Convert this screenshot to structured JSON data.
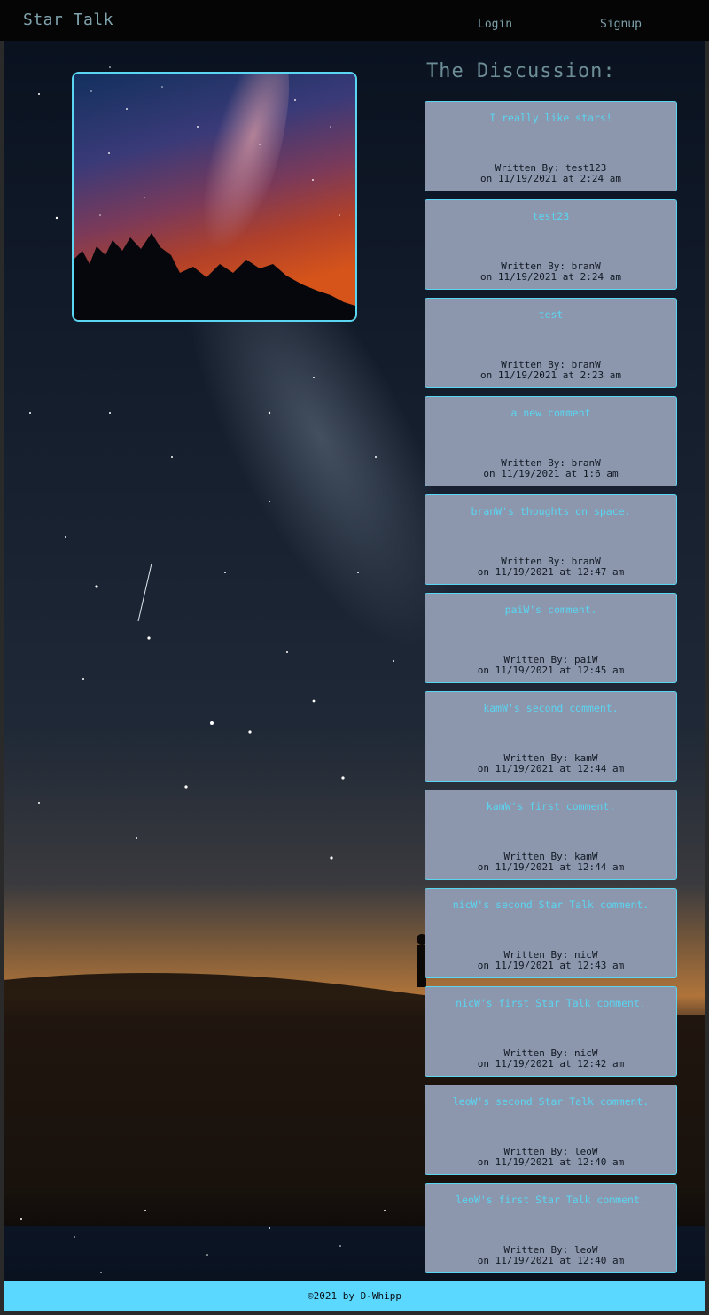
{
  "navbar": {
    "brand": "Star Talk",
    "login": "Login",
    "signup": "Signup"
  },
  "discussion": {
    "title": "The Discussion:",
    "posts": [
      {
        "title": "I really like stars!",
        "author": "Written By: test123",
        "date": "on 11/19/2021 at 2:24 am"
      },
      {
        "title": "test23",
        "author": "Written By: branW",
        "date": "on 11/19/2021 at 2:24 am"
      },
      {
        "title": "test",
        "author": "Written By: branW",
        "date": "on 11/19/2021 at 2:23 am"
      },
      {
        "title": "a new comment",
        "author": "Written By: branW",
        "date": "on 11/19/2021 at 1:6 am"
      },
      {
        "title": "branW's thoughts on space.",
        "author": "Written By: branW",
        "date": "on 11/19/2021 at 12:47 am"
      },
      {
        "title": "paiW's comment.",
        "author": "Written By: paiW",
        "date": "on 11/19/2021 at 12:45 am"
      },
      {
        "title": "kamW's second comment.",
        "author": "Written By: kamW",
        "date": "on 11/19/2021 at 12:44 am"
      },
      {
        "title": "kamW's first comment.",
        "author": "Written By: kamW",
        "date": "on 11/19/2021 at 12:44 am"
      },
      {
        "title": "nicW's second Star Talk comment.",
        "author": "Written By: nicW",
        "date": "on 11/19/2021 at 12:43 am"
      },
      {
        "title": "nicW's first Star Talk comment.",
        "author": "Written By: nicW",
        "date": "on 11/19/2021 at 12:42 am"
      },
      {
        "title": "leoW's second Star Talk comment.",
        "author": "Written By: leoW",
        "date": "on 11/19/2021 at 12:40 am"
      },
      {
        "title": "leoW's first Star Talk comment.",
        "author": "Written By: leoW",
        "date": "on 11/19/2021 at 12:40 am"
      }
    ]
  },
  "footer": {
    "text": "©2021 by D-Whipp"
  },
  "colors": {
    "accent": "#5ad6f2",
    "card_background": "#8c96ac",
    "navbar_background": "#050505",
    "footer_background": "#5ad8ff"
  },
  "images": {
    "hero": "milky-way-over-trees-photo",
    "background": "night-sky-milky-way-hill-photo"
  }
}
